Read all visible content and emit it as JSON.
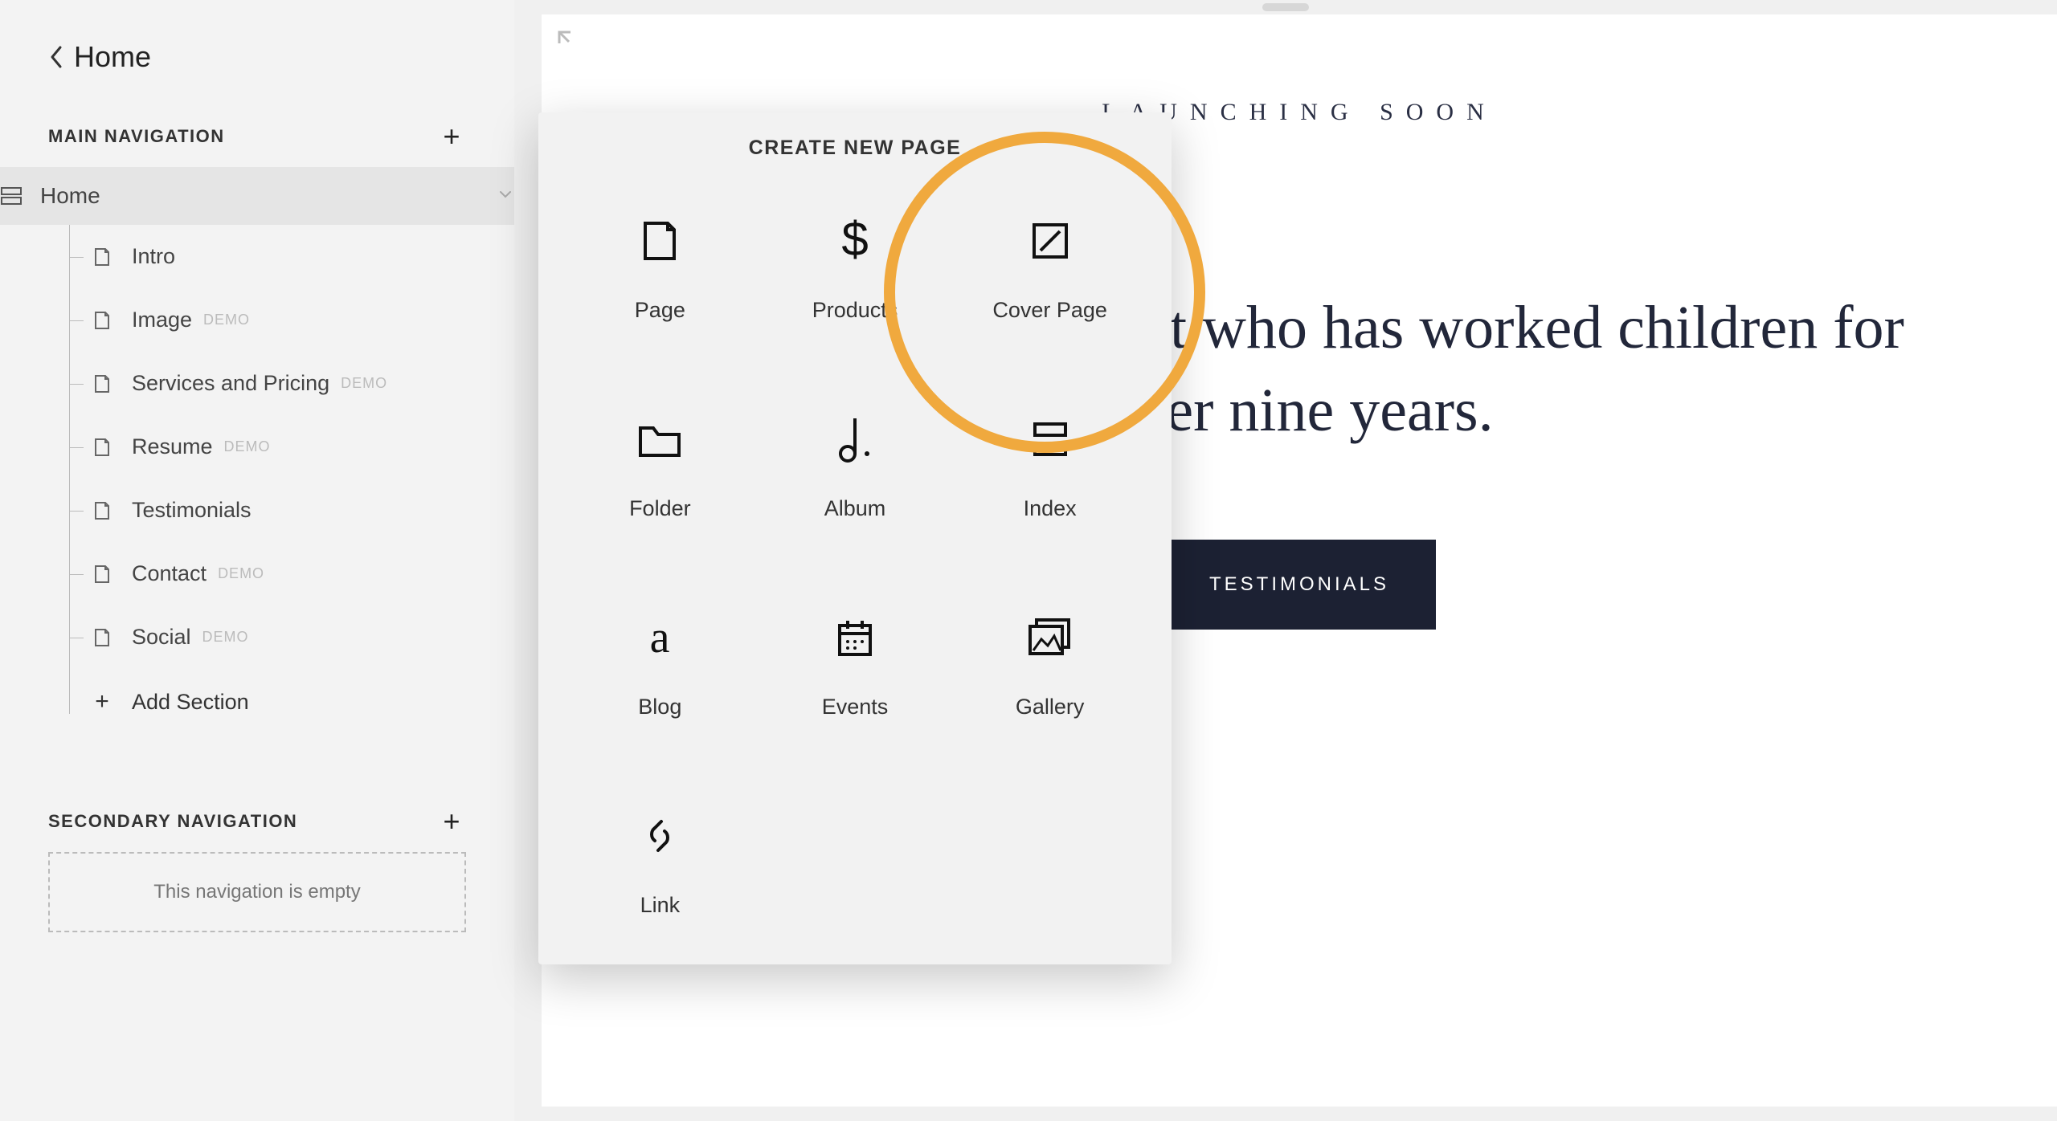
{
  "back": {
    "label": "Home"
  },
  "sections": {
    "main": {
      "title": "MAIN NAVIGATION",
      "home": {
        "label": "Home"
      },
      "children": [
        {
          "label": "Intro",
          "demo": false
        },
        {
          "label": "Image",
          "demo": true
        },
        {
          "label": "Services and Pricing",
          "demo": true
        },
        {
          "label": "Resume",
          "demo": true
        },
        {
          "label": "Testimonials",
          "demo": false
        },
        {
          "label": "Contact",
          "demo": true
        },
        {
          "label": "Social",
          "demo": true
        }
      ],
      "add_section": "Add Section",
      "demo_badge": "DEMO"
    },
    "secondary": {
      "title": "SECONDARY NAVIGATION",
      "empty_message": "This navigation is empty"
    }
  },
  "popup": {
    "title": "CREATE NEW PAGE",
    "items": [
      {
        "id": "page",
        "label": "Page"
      },
      {
        "id": "products",
        "label": "Products"
      },
      {
        "id": "cover-page",
        "label": "Cover Page"
      },
      {
        "id": "folder",
        "label": "Folder"
      },
      {
        "id": "album",
        "label": "Album"
      },
      {
        "id": "index",
        "label": "Index"
      },
      {
        "id": "blog",
        "label": "Blog"
      },
      {
        "id": "events",
        "label": "Events"
      },
      {
        "id": "gallery",
        "label": "Gallery"
      },
      {
        "id": "link",
        "label": "Link"
      }
    ]
  },
  "preview": {
    "eyebrow": "LAUNCHING SOON",
    "hero": "re! I'm a graduate nt who has worked children for over nine years.",
    "cta": "TESTIMONIALS"
  }
}
